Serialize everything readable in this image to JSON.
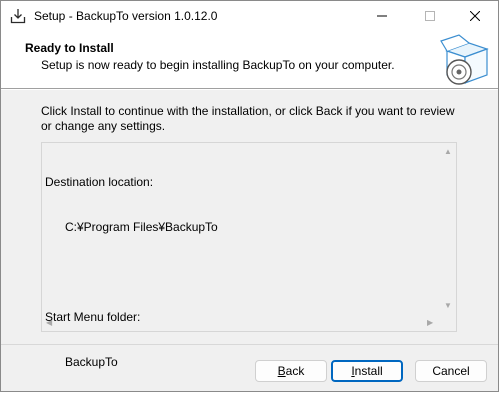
{
  "window": {
    "title": "Setup - BackupTo version 1.0.12.0"
  },
  "header": {
    "title": "Ready to Install",
    "subtitle": "Setup is now ready to begin installing BackupTo on your computer."
  },
  "description": "Click Install to continue with the installation, or click Back if you want to review or change any settings.",
  "memo": {
    "lines": [
      "Destination location:",
      "      C:¥Program Files¥BackupTo",
      "",
      "Start Menu folder:",
      "      BackupTo"
    ]
  },
  "buttons": {
    "back": {
      "accel": "B",
      "rest": "ack"
    },
    "install": {
      "accel": "I",
      "rest": "nstall"
    },
    "cancel": "Cancel"
  },
  "icons": {
    "app": "setup-download-icon",
    "wizard": "box-disc-icon"
  },
  "colors": {
    "accent": "#0067c0",
    "window_bg": "#f0f0f0",
    "header_bg": "#ffffff"
  }
}
